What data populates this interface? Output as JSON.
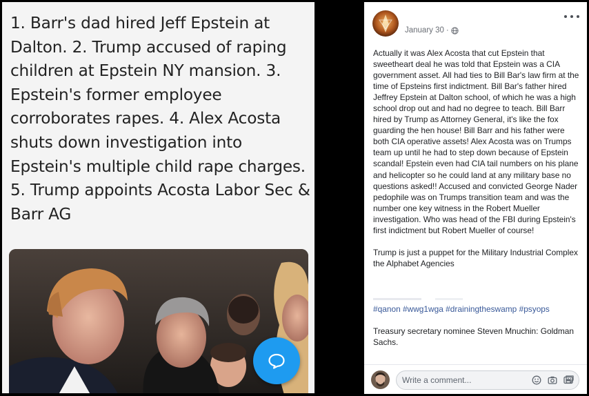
{
  "meme": {
    "text": "1. Barr's dad hired Jeff Epstein at Dalton. 2. Trump accused of raping children at Epstein NY mansion. 3. Epstein's former employee corroborates rapes. 4. Alex Acosta shuts down investigation into Epstein's multiple child rape charges. 5. Trump appoints Acosta Labor Sec & Barr AG"
  },
  "post": {
    "date": "January 30",
    "date_separator": "·",
    "privacy_icon": "globe-icon",
    "more_icon": "more-options-icon",
    "body_p1": "Actually it was Alex Acosta that cut Epstein that sweetheart deal he was told that Epstein was a CIA government asset. All had ties to Bill Bar's law firm at the time of Epsteins first indictment. Bill Bar's father hired Jeffrey Epstein at Dalton school, of which he was a high school drop out and had no degree to teach. Bill Barr hired by Trump as Attorney General, it's like the fox guarding the hen house! Bill Barr and his father were both CIA operative assets! Alex Acosta was on Trumps team up until he had to step down because of Epstein scandal! Epstein even had CIA tail numbers on his plane and helicopter so he could land at any military base no questions asked!! Accused and convicted George Nader pedophile was on Trumps transition team and was the number one key witness in the Robert Mueller investigation. Who was head of the FBI during Epstein's first indictment but Robert Mueller of course!",
    "body_p2": "Trump is just a puppet for the Military Industrial Complex the Alphabet Agencies",
    "hashtags": [
      "#qanon",
      "#wwg1wga",
      "#drainingtheswamp",
      "#psyops"
    ],
    "footer_text": "Treasury secretary nominee Steven Mnuchin: Goldman Sachs."
  },
  "comment": {
    "placeholder": "Write a comment...",
    "icons": [
      "emoji-icon",
      "camera-icon",
      "gif-icon",
      "sticker-icon"
    ]
  },
  "colors": {
    "link": "#385898",
    "fab": "#1e9bf0",
    "meta": "#6a6e75"
  }
}
